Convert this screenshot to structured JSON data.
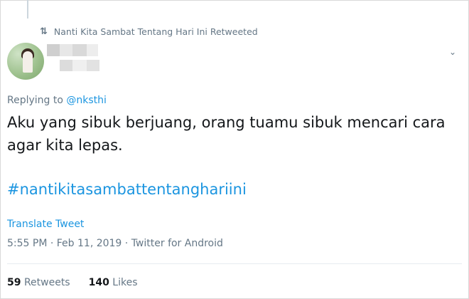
{
  "retweet_context": {
    "icon": "retweet-icon",
    "text": "Nanti Kita Sambat Tentang Hari Ini Retweeted"
  },
  "author": {
    "avatar": "avatar",
    "name_hidden": true
  },
  "reply": {
    "prefix": "Replying to",
    "mention": "@nksthi"
  },
  "tweet": {
    "text": "Aku yang sibuk berjuang, orang tuamu sibuk mencari cara agar kita lepas.",
    "hashtag": "#nantikitasambattentanghariini",
    "translate_label": "Translate Tweet",
    "meta": "5:55 PM · Feb 11, 2019 · Twitter for Android"
  },
  "stats": {
    "retweets_count": "59",
    "retweets_label": "Retweets",
    "likes_count": "140",
    "likes_label": "Likes"
  },
  "colors": {
    "link": "#1b95e0",
    "muted": "#657786",
    "text": "#14171a"
  }
}
